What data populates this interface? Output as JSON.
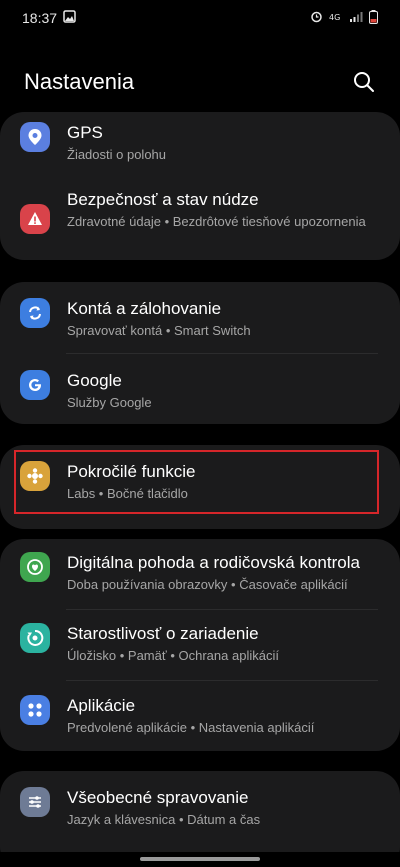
{
  "status_bar": {
    "time": "18:37",
    "icons": [
      "gallery-icon",
      "alarm-icon",
      "volte-icon",
      "signal-icon",
      "battery-icon"
    ]
  },
  "header": {
    "title": "Nastavenia"
  },
  "items": {
    "gps": {
      "title": "GPS",
      "subtitle": "Žiadosti o polohu",
      "color": "#5b7fe0"
    },
    "safety": {
      "title": "Bezpečnosť a stav núdze",
      "subtitle": "Zdravotné údaje  •  Bezdrôtové tiesňové upozornenia",
      "color": "#d9434a"
    },
    "accounts": {
      "title": "Kontá a zálohovanie",
      "subtitle": "Spravovať kontá  •  Smart Switch",
      "color": "#3d7ee0"
    },
    "google": {
      "title": "Google",
      "subtitle": "Služby Google",
      "color": "#3d7ee0"
    },
    "advanced": {
      "title": "Pokročilé funkcie",
      "subtitle": "Labs  •  Bočné tlačidlo",
      "color": "#d9a33b"
    },
    "wellbeing": {
      "title": "Digitálna pohoda a rodičovská kontrola",
      "subtitle": "Doba používania obrazovky  •  Časovače aplikácií",
      "color": "#3fa64f"
    },
    "care": {
      "title": "Starostlivosť o zariadenie",
      "subtitle": "Úložisko  •  Pamäť  •  Ochrana aplikácií",
      "color": "#2bb3a0"
    },
    "apps": {
      "title": "Aplikácie",
      "subtitle": "Predvolené aplikácie  •  Nastavenia aplikácií",
      "color": "#4a7fe3"
    },
    "general": {
      "title": "Všeobecné spravovanie",
      "subtitle": "Jazyk a klávesnica  •  Dátum a čas",
      "color": "#6e7b95"
    }
  }
}
